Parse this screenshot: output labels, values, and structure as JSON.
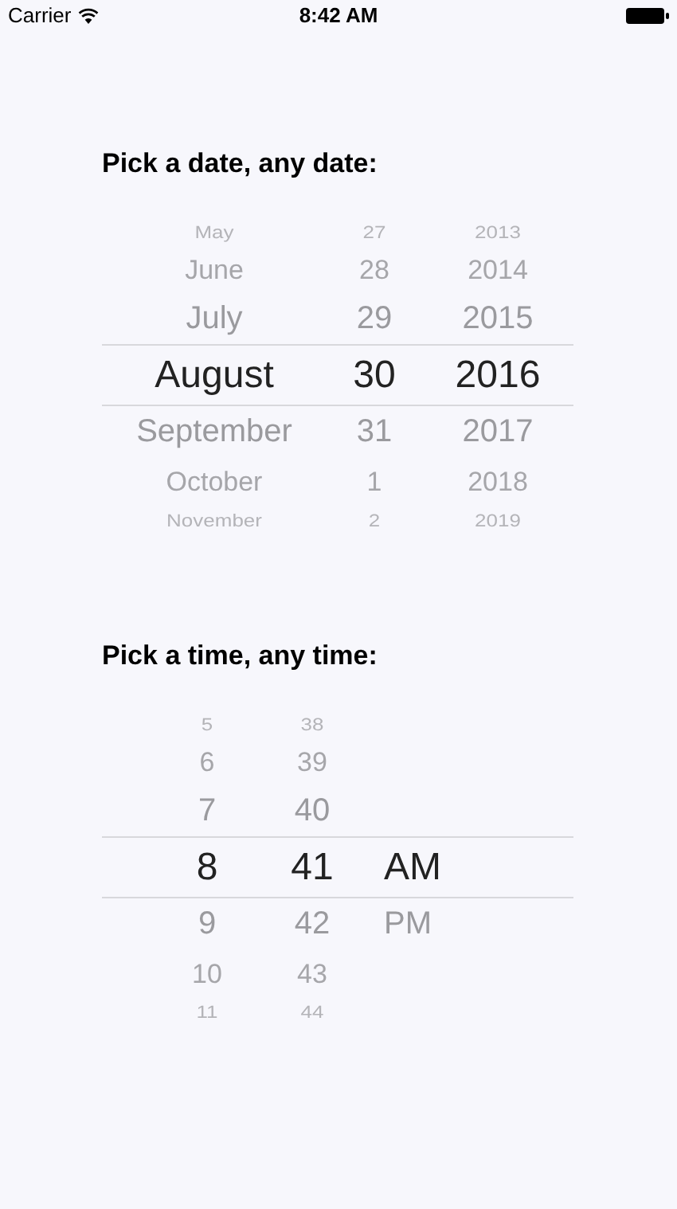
{
  "status_bar": {
    "carrier": "Carrier",
    "time": "8:42 AM"
  },
  "date_picker": {
    "title": "Pick a date, any date:",
    "columns": [
      {
        "items": [
          {
            "text": "May",
            "selected": false
          },
          {
            "text": "June",
            "selected": false
          },
          {
            "text": "July",
            "selected": false
          },
          {
            "text": "August",
            "selected": true
          },
          {
            "text": "September",
            "selected": false
          },
          {
            "text": "October",
            "selected": false
          },
          {
            "text": "November",
            "selected": false
          }
        ]
      },
      {
        "items": [
          {
            "text": "27",
            "selected": false
          },
          {
            "text": "28",
            "selected": false
          },
          {
            "text": "29",
            "selected": false
          },
          {
            "text": "30",
            "selected": true
          },
          {
            "text": "31",
            "selected": false
          },
          {
            "text": "1",
            "selected": false
          },
          {
            "text": "2",
            "selected": false
          }
        ]
      },
      {
        "items": [
          {
            "text": "2013",
            "selected": false
          },
          {
            "text": "2014",
            "selected": false
          },
          {
            "text": "2015",
            "selected": false
          },
          {
            "text": "2016",
            "selected": true
          },
          {
            "text": "2017",
            "selected": false
          },
          {
            "text": "2018",
            "selected": false
          },
          {
            "text": "2019",
            "selected": false
          }
        ]
      }
    ]
  },
  "time_picker": {
    "title": "Pick a time, any time:",
    "columns": [
      {
        "items": [
          {
            "text": "5",
            "selected": false
          },
          {
            "text": "6",
            "selected": false
          },
          {
            "text": "7",
            "selected": false
          },
          {
            "text": "8",
            "selected": true
          },
          {
            "text": "9",
            "selected": false
          },
          {
            "text": "10",
            "selected": false
          },
          {
            "text": "11",
            "selected": false
          }
        ]
      },
      {
        "items": [
          {
            "text": "38",
            "selected": false
          },
          {
            "text": "39",
            "selected": false
          },
          {
            "text": "40",
            "selected": false
          },
          {
            "text": "41",
            "selected": true
          },
          {
            "text": "42",
            "selected": false
          },
          {
            "text": "43",
            "selected": false
          },
          {
            "text": "44",
            "selected": false
          }
        ]
      },
      {
        "items": [
          {
            "text": "AM",
            "selected": true
          },
          {
            "text": "PM",
            "selected": false
          }
        ]
      }
    ]
  }
}
